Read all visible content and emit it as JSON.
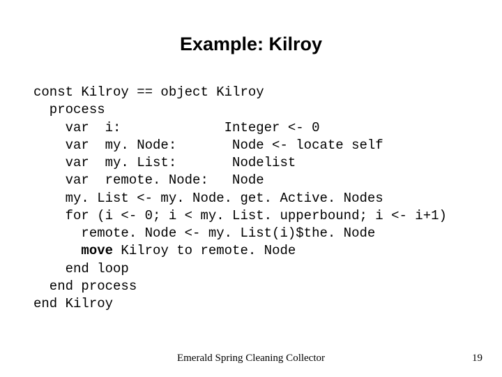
{
  "title": "Example: Kilroy",
  "code": {
    "l0": "const Kilroy == object Kilroy",
    "l1": "  process",
    "l2": "    var  i:             Integer <- 0",
    "l3": "    var  my. Node:       Node <- locate self",
    "l4": "    var  my. List:       Nodelist",
    "l5": "    var  remote. Node:   Node",
    "l6": "    my. List <- my. Node. get. Active. Nodes",
    "l7": "    for (i <- 0; i < my. List. upperbound; i <- i+1)",
    "l8a": "      remote. Node <- my. List(i)$the. Node",
    "l8b_pre": "      ",
    "l8b_kw": "move",
    "l8b_post": " Kilroy to remote. Node",
    "l9": "    end loop",
    "l10": "  end process",
    "l11": "end Kilroy"
  },
  "footer": {
    "center": "Emerald Spring Cleaning Collector",
    "page": "19"
  }
}
